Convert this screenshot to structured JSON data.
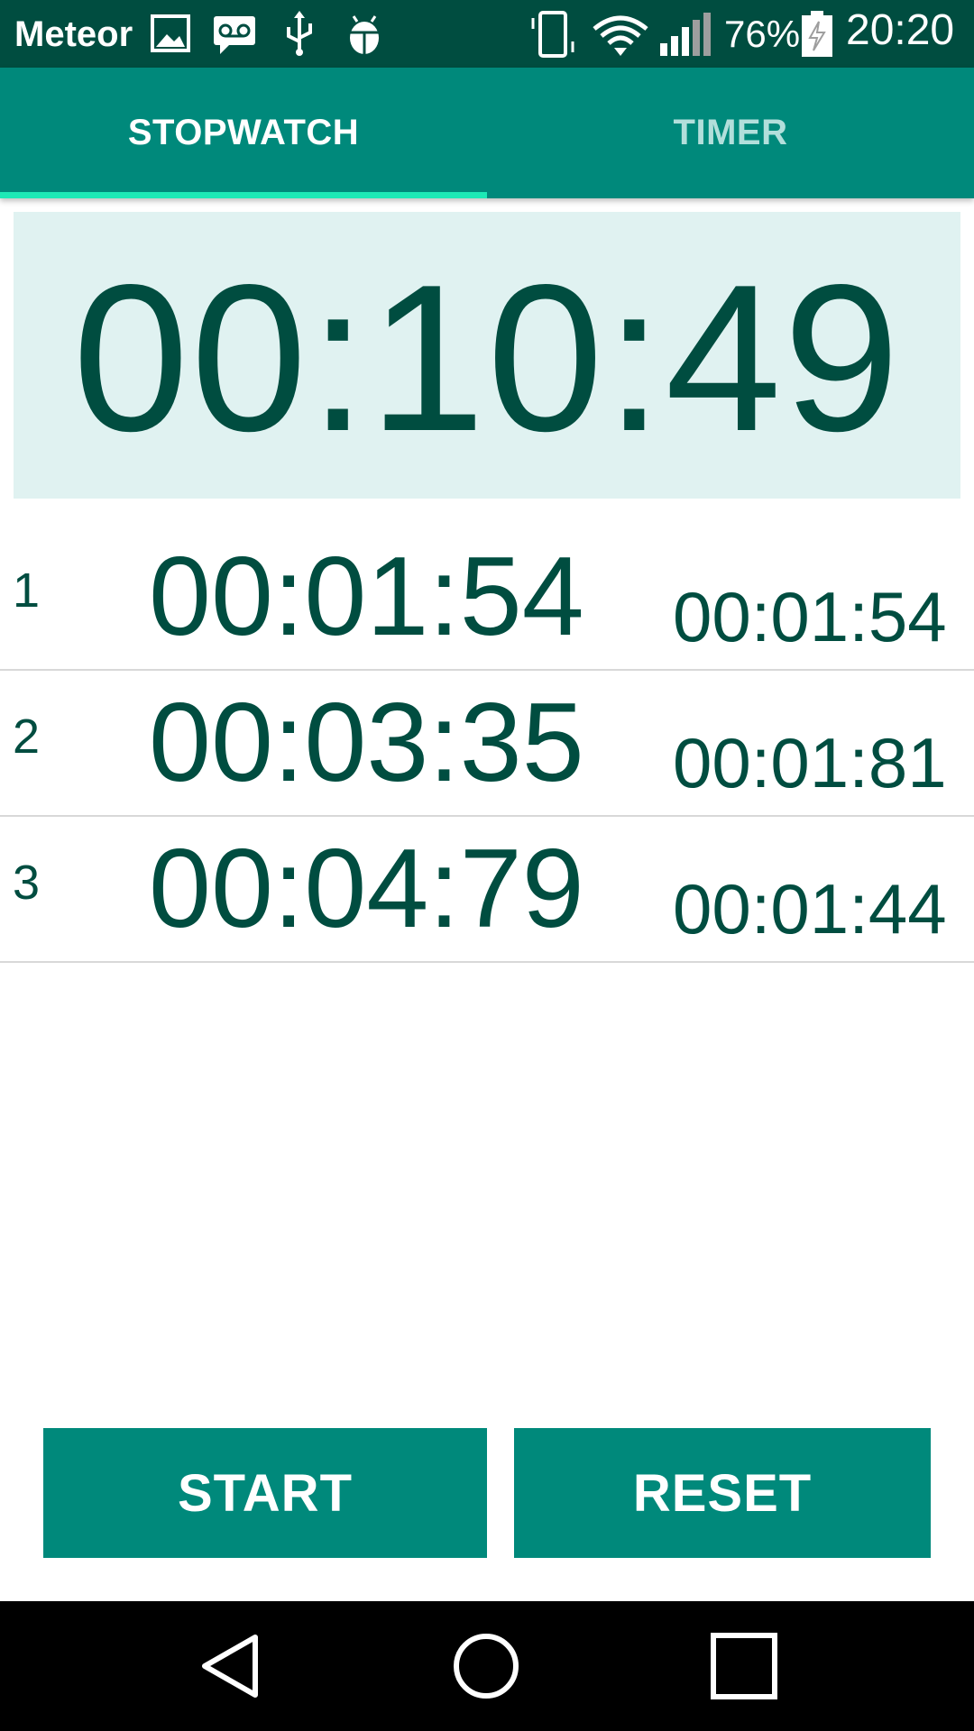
{
  "status_bar": {
    "carrier": "Meteor",
    "battery_percent": "76%",
    "time": "20:20",
    "icons": [
      "image-icon",
      "voicemail-icon",
      "usb-icon",
      "android-debug-icon",
      "vibrate-icon",
      "wifi-icon",
      "signal-icon",
      "battery-charging-icon"
    ]
  },
  "tabs": [
    {
      "label": "STOPWATCH",
      "active": true
    },
    {
      "label": "TIMER",
      "active": false
    }
  ],
  "stopwatch": {
    "elapsed": "00:10:49"
  },
  "laps": [
    {
      "number": "1",
      "total": "00:01:54",
      "split": "00:01:54"
    },
    {
      "number": "2",
      "total": "00:03:35",
      "split": "00:01:81"
    },
    {
      "number": "3",
      "total": "00:04:79",
      "split": "00:01:44"
    }
  ],
  "buttons": {
    "start": "START",
    "reset": "RESET"
  },
  "nav_bar": {
    "icons": [
      "back-icon",
      "home-icon",
      "recents-icon"
    ]
  },
  "colors": {
    "status_bar": "#004d40",
    "primary": "#00897b",
    "accent": "#1de9b6",
    "text_dark": "#004d40",
    "timer_bg": "#e0f2f1"
  }
}
